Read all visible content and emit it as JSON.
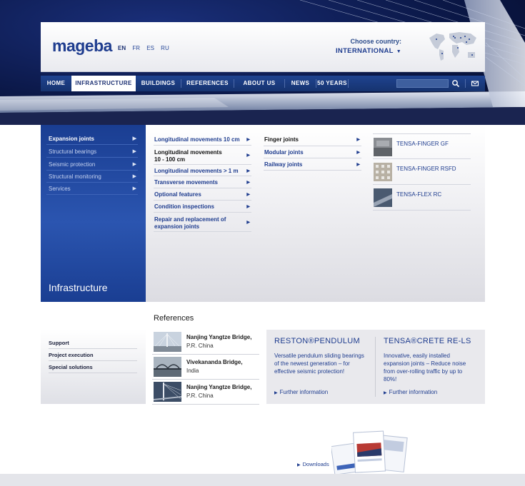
{
  "header": {
    "logo": "mageba",
    "languages": [
      "EN",
      "FR",
      "ES",
      "RU"
    ],
    "choose_country_label": "Choose country:",
    "country_value": "INTERNATIONAL"
  },
  "nav": {
    "items": [
      "HOME",
      "INFRASTRUCTURE",
      "BUILDINGS",
      "REFERENCES",
      "ABOUT US",
      "NEWS",
      "50 YEARS"
    ],
    "active": "INFRASTRUCTURE"
  },
  "sidebar": {
    "items": [
      "Expansion joints",
      "Structural bearings",
      "Seismic protection",
      "Structural monitoring",
      "Services"
    ],
    "active": "Expansion joints",
    "title": "Infrastructure"
  },
  "submenu": {
    "col2": [
      "Longitudinal movements 10 cm",
      "Longitudinal movements 10 - 100 cm",
      "Longitudinal movements > 1 m",
      "Transverse movements",
      "Optional features",
      "Condition inspections",
      "Repair and replacement of expansion joints"
    ],
    "col2_line_a": "Longitudinal movements",
    "col2_line_b": "10 - 100 cm",
    "col3": [
      "Finger joints",
      "Modular joints",
      "Railway joints"
    ],
    "products": [
      "TENSA-FINGER GF",
      "TENSA-FINGER RSFD",
      "TENSA-FLEX RC"
    ]
  },
  "references": {
    "title": "References",
    "left_links": [
      "Support",
      "Project execution",
      "Special solutions"
    ],
    "items": [
      {
        "name": "Nanjing Yangtze Bridge,",
        "country": "P.R. China"
      },
      {
        "name": "Vivekananda Bridge,",
        "country": "India"
      },
      {
        "name": "Nanjing Yangtze Bridge,",
        "country": "P.R. China"
      }
    ]
  },
  "promos": [
    {
      "title": "RESTON®PENDULUM",
      "text": [
        "Versatile pendulum sliding bearings",
        "of the newest generation – for",
        "effective seismic protection!"
      ],
      "link": "Further information"
    },
    {
      "title": "TENSA®CRETE RE-LS",
      "text": [
        "Innovative, easily installed",
        "expansion joints – Reduce noise",
        "from over-rolling traffic by up to",
        "80%!"
      ],
      "link": "Further information"
    }
  ],
  "downloads_label": "Downloads",
  "colors": {
    "brand_blue": "#1f3d8f",
    "nav_blue": "#1f4390",
    "sidebar_blue": "#2b55b0"
  }
}
